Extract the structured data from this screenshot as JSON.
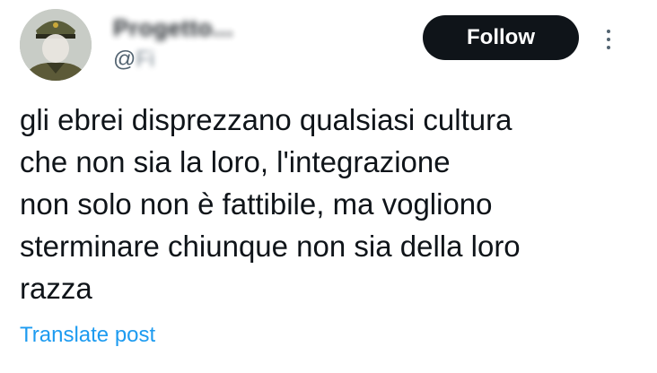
{
  "author": {
    "display_name": "Progetto...",
    "handle_at": "@",
    "handle": "Fi"
  },
  "actions": {
    "follow_label": "Follow",
    "more_icon": "more-vertical-icon"
  },
  "post": {
    "lines": [
      "gli ebrei disprezzano qualsiasi cultura",
      "che non sia la loro, l'integrazione",
      "non solo non è fattibile, ma vogliono",
      "sterminare chiunque non sia della loro",
      "razza"
    ]
  },
  "footer": {
    "translate_label": "Translate post"
  },
  "colors": {
    "text": "#0f1419",
    "muted": "#536471",
    "link": "#1d9bf0",
    "follow_bg": "#0f1419",
    "follow_text": "#ffffff"
  }
}
